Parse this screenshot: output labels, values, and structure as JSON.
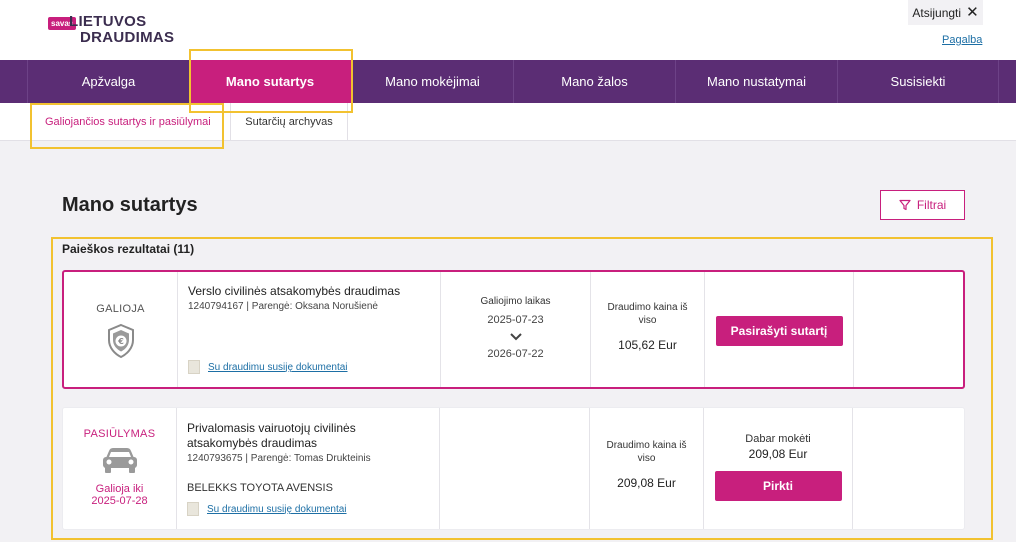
{
  "header": {
    "logo_badge": "savas",
    "logo_line1": "LIETUVOS",
    "logo_line2": "DRAUDIMAS",
    "logout_label": "Atsijungti",
    "help_label": "Pagalba"
  },
  "nav": {
    "items": [
      {
        "label": "Apžvalga"
      },
      {
        "label": "Mano sutartys"
      },
      {
        "label": "Mano mokėjimai"
      },
      {
        "label": "Mano žalos"
      },
      {
        "label": "Mano nustatymai"
      },
      {
        "label": "Susisiekti"
      }
    ]
  },
  "subnav": {
    "items": [
      {
        "label": "Galiojančios sutartys ir pasiūlymai"
      },
      {
        "label": "Sutarčių archyvas"
      }
    ]
  },
  "page": {
    "title": "Mano sutartys",
    "filter_label": "Filtrai",
    "results_label": "Paieškos rezultatai (11)"
  },
  "cards": [
    {
      "status": "GALIOJA",
      "title": "Verslo civilinės atsakomybės draudimas",
      "meta": "1240794167 | Parengė: Oksana Norušienė",
      "docs_label": "Su draudimu susiję dokumentai",
      "validity_label": "Galiojimo laikas",
      "date_from": "2025-07-23",
      "date_to": "2026-07-22",
      "price_label": "Draudimo kaina iš viso",
      "price": "105,62 Eur",
      "action_label": "Pasirašyti sutartį"
    },
    {
      "status": "PASIŪLYMAS",
      "valid_until_label": "Galioja iki",
      "valid_until": "2025-07-28",
      "title": "Privalomasis vairuotojų civilinės atsakomybės draudimas",
      "meta": "1240793675 | Parengė: Tomas Drukteinis",
      "vehicle": "BELEKKS TOYOTA AVENSIS",
      "docs_label": "Su draudimu susiję dokumentai",
      "price_label": "Draudimo kaina iš viso",
      "price": "209,08 Eur",
      "pay_now_label": "Dabar mokėti",
      "pay_now_value": "209,08 Eur",
      "action_label": "Pirkti"
    }
  ],
  "colors": {
    "brand_purple": "#5b2d74",
    "accent_magenta": "#c81f7d",
    "highlight_yellow": "#f2c230",
    "link_blue": "#1d6fa5"
  }
}
